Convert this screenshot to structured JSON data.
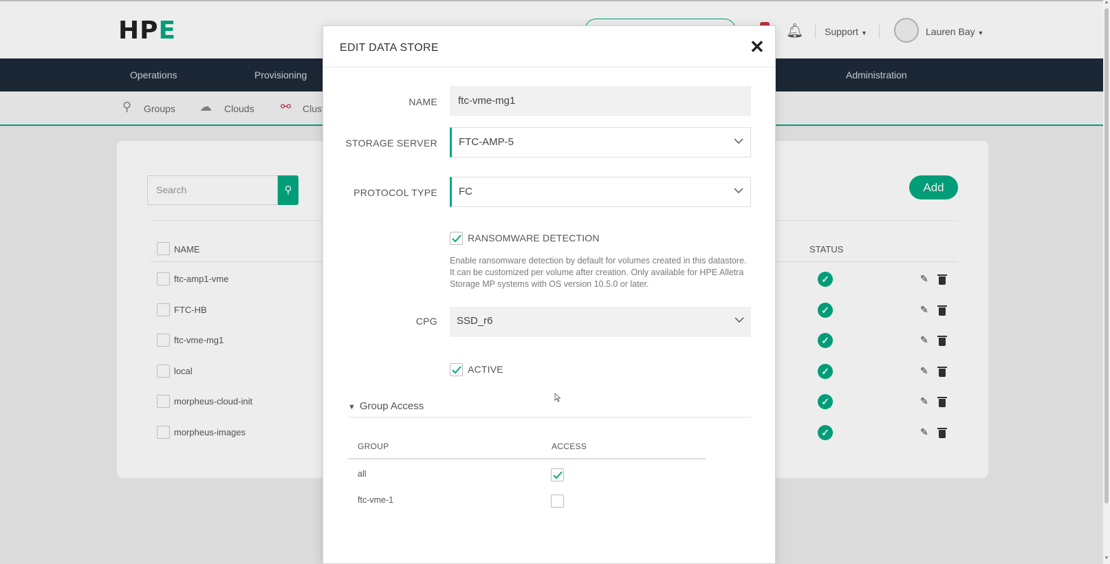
{
  "header": {
    "logo_text": "HPE",
    "support_label": "Support",
    "user_name": "Lauren Bay"
  },
  "nav": {
    "items": [
      "Operations",
      "Provisioning",
      "Administration"
    ]
  },
  "subnav": {
    "items": [
      "Groups",
      "Clouds",
      "Clust"
    ]
  },
  "list": {
    "search_placeholder": "Search",
    "add_label": "Add",
    "columns": {
      "name": "NAME",
      "status": "STATUS"
    },
    "rows": [
      {
        "name": "ftc-amp1-vme",
        "status": "ok"
      },
      {
        "name": "FTC-HB",
        "status": "ok"
      },
      {
        "name": "ftc-vme-mg1",
        "status": "ok"
      },
      {
        "name": "local",
        "status": "ok"
      },
      {
        "name": "morpheus-cloud-init",
        "status": "ok"
      },
      {
        "name": "morpheus-images",
        "status": "ok"
      }
    ]
  },
  "modal": {
    "title": "EDIT DATA STORE",
    "fields": {
      "name_label": "NAME",
      "name_value": "ftc-vme-mg1",
      "storage_server_label": "STORAGE SERVER",
      "storage_server_value": "FTC-AMP-5",
      "protocol_type_label": "PROTOCOL TYPE",
      "protocol_type_value": "FC",
      "ransomware_label": "RANSOMWARE DETECTION",
      "ransomware_checked": true,
      "ransomware_help": "Enable ransomware detection by default for volumes created in this datastore. It can be customized per volume after creation. Only available for HPE Alletra Storage MP systems with OS version 10.5.0 or later.",
      "cpg_label": "CPG",
      "cpg_value": "SSD_r6",
      "active_label": "ACTIVE",
      "active_checked": true
    },
    "group_access": {
      "section_label": "Group Access",
      "columns": {
        "group": "GROUP",
        "access": "ACCESS"
      },
      "rows": [
        {
          "group": "all",
          "access": true
        },
        {
          "group": "ftc-vme-1",
          "access": false
        }
      ]
    }
  },
  "colors": {
    "accent": "#01a982",
    "nav_bg": "#1f2b3b"
  }
}
